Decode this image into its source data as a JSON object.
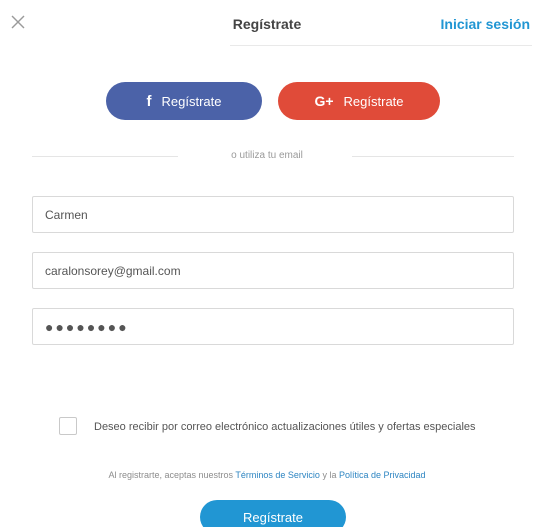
{
  "header": {
    "close_icon": "close-icon",
    "title": "Regístrate",
    "login_link": "Iniciar sesión"
  },
  "social": {
    "facebook": {
      "icon_glyph": "f",
      "label": "Regístrate",
      "color": "#4b62a8"
    },
    "google": {
      "icon_glyph": "G+",
      "label": "Regístrate",
      "color": "#e04b39"
    }
  },
  "divider_text": "o utiliza tu email",
  "form": {
    "name_value": "Carmen",
    "email_value": "caralonsorey@gmail.com",
    "password_value": "●●●●●●●●"
  },
  "opt_in": {
    "checked": false,
    "label": "Deseo recibir por correo electrónico actualizaciones útiles y ofertas especiales"
  },
  "terms": {
    "prefix": "Al registrarte, aceptas nuestros ",
    "terms_link": "Términos de Servicio",
    "middle": " y la ",
    "privacy_link": "Política de Privacidad"
  },
  "submit_label": "Regístrate",
  "colors": {
    "accent": "#2196d3",
    "facebook": "#4b62a8",
    "google": "#e04b39"
  }
}
